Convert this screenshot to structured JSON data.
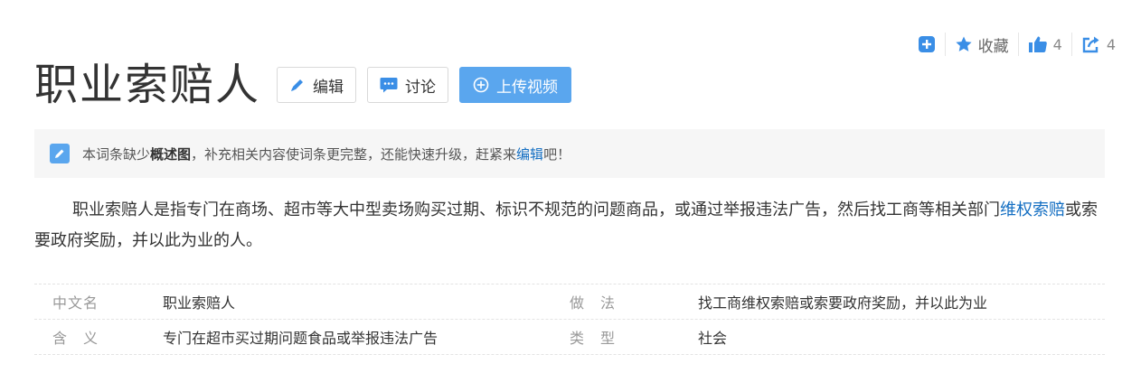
{
  "tools": {
    "favorite_label": "收藏",
    "like_count": "4",
    "share_count": "4"
  },
  "title": "职业索赔人",
  "buttons": {
    "edit": "编辑",
    "discuss": "讨论",
    "upload_video": "上传视频"
  },
  "notice": {
    "prefix": "本词条缺少",
    "missing": "概述图",
    "middle": "，补充相关内容使词条更完整，还能快速升级，赶紧来",
    "link": "编辑",
    "suffix": "吧！"
  },
  "summary": {
    "part1": "职业索赔人是指专门在商场、超市等大中型卖场购买过期、标识不规范的问题商品，或通过举报违法广告，然后找工商等相关部门",
    "link": "维权索赔",
    "part2": "或索要政府奖励，并以此为业的人。"
  },
  "info": [
    {
      "k1": "中文名",
      "v1": "职业索赔人",
      "k2": "做　法",
      "v2": "找工商维权索赔或索要政府奖励，并以此为业"
    },
    {
      "k1": "含　义",
      "v1": "专门在超市买过期问题食品或举报违法广告",
      "k2": "类　型",
      "v2": "社会"
    }
  ],
  "colors": {
    "accent": "#5aa6ee",
    "link": "#136ec2",
    "icon_blue": "#3a8ee6"
  }
}
